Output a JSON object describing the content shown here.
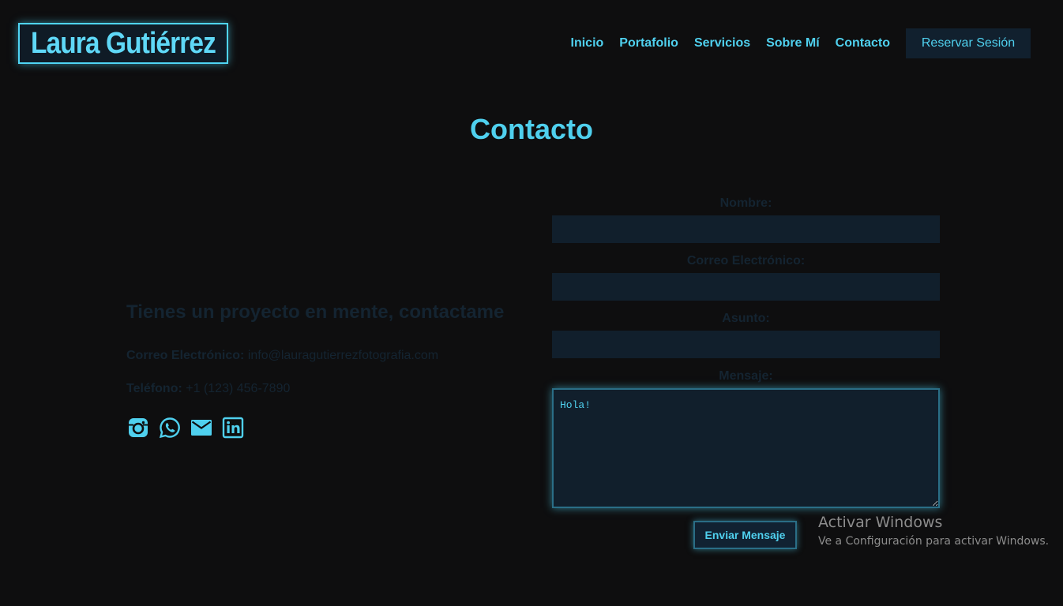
{
  "header": {
    "logo_text": "Laura Gutiérrez",
    "nav": [
      "Inicio",
      "Portafolio",
      "Servicios",
      "Sobre Mí",
      "Contacto"
    ],
    "cta_label": "Reservar Sesión"
  },
  "page": {
    "title": "Contacto"
  },
  "info": {
    "heading": "Tienes un proyecto en mente, contactame",
    "email_label": "Correo Electrónico:",
    "email_value": "info@lauragutierrezfotografia.com",
    "phone_label": "Teléfono:",
    "phone_value": "+1 (123) 456-7890",
    "social_icons": [
      "instagram-icon",
      "whatsapp-icon",
      "mail-icon",
      "linkedin-icon"
    ]
  },
  "form": {
    "name_label": "Nombre:",
    "name_value": "",
    "email_label": "Correo Electrónico:",
    "email_value": "",
    "subject_label": "Asunto:",
    "subject_value": "",
    "message_label": "Mensaje:",
    "message_value": "Hola!",
    "submit_label": "Enviar Mensaje"
  },
  "watermark": {
    "line1": "Activar Windows",
    "line2": "Ve a Configuración para activar Windows."
  },
  "colors": {
    "background": "#0e0e0f",
    "accent": "#4fd0ee",
    "field_bg": "#111f2c",
    "dim_text": "#142431"
  }
}
